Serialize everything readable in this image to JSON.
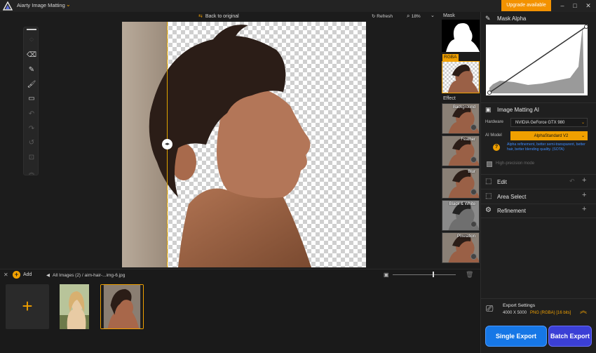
{
  "app": {
    "title": "Aiarty Image Matting",
    "upgrade_label": "Upgrade available",
    "window_controls": [
      "minimize-icon",
      "maximize-icon",
      "close-icon"
    ]
  },
  "canvas_toolbar": {
    "back_to_original": "Back to original",
    "refresh": "Refresh",
    "zoom": "18%"
  },
  "tools": [
    "brush-icon",
    "eraser-icon",
    "pen-icon",
    "paint-brush-icon",
    "roller-icon",
    "undo-icon",
    "redo-icon",
    "reset-icon",
    "fit-icon",
    "collapse-icon"
  ],
  "thumbnails": {
    "mask_label": "Mask",
    "rgba_label": "RGBA",
    "effect_label": "Effect",
    "effects": [
      {
        "label": "Background"
      },
      {
        "label": "Feather"
      },
      {
        "label": "Blur"
      },
      {
        "label": "Black & White"
      },
      {
        "label": "Pixelation"
      }
    ]
  },
  "right_panel": {
    "mask_alpha": "Mask Alpha",
    "image_matting_ai": "Image Matting AI",
    "hardware_label": "Hardware",
    "hardware_value": "NVIDIA GeForce GTX 980",
    "ai_model_label": "AI Model",
    "ai_model_value": "AlphaStandard  V2",
    "ai_model_desc": "Alpha refinement, better semi-transparent, better hair, better blending quality. (SOTA)",
    "high_precision": "High-precision mode",
    "sections": [
      {
        "label": "Edit"
      },
      {
        "label": "Area Select"
      },
      {
        "label": "Refinement"
      }
    ],
    "export_settings_title": "Export Settings",
    "export_size": "4000 X 5000",
    "export_format": "PNG (RGBA) [16 bits]",
    "single_export": "Single Export",
    "batch_export": "Batch Export"
  },
  "bottom_bar": {
    "add_label": "Add",
    "breadcrumb": "All Images (2)  /   aim-hair-...img-6.jpg"
  },
  "colors": {
    "accent": "#f0a000",
    "single_export": "#1677e6",
    "batch_export": "#3b3fd6",
    "background": "#1c1c1c"
  }
}
